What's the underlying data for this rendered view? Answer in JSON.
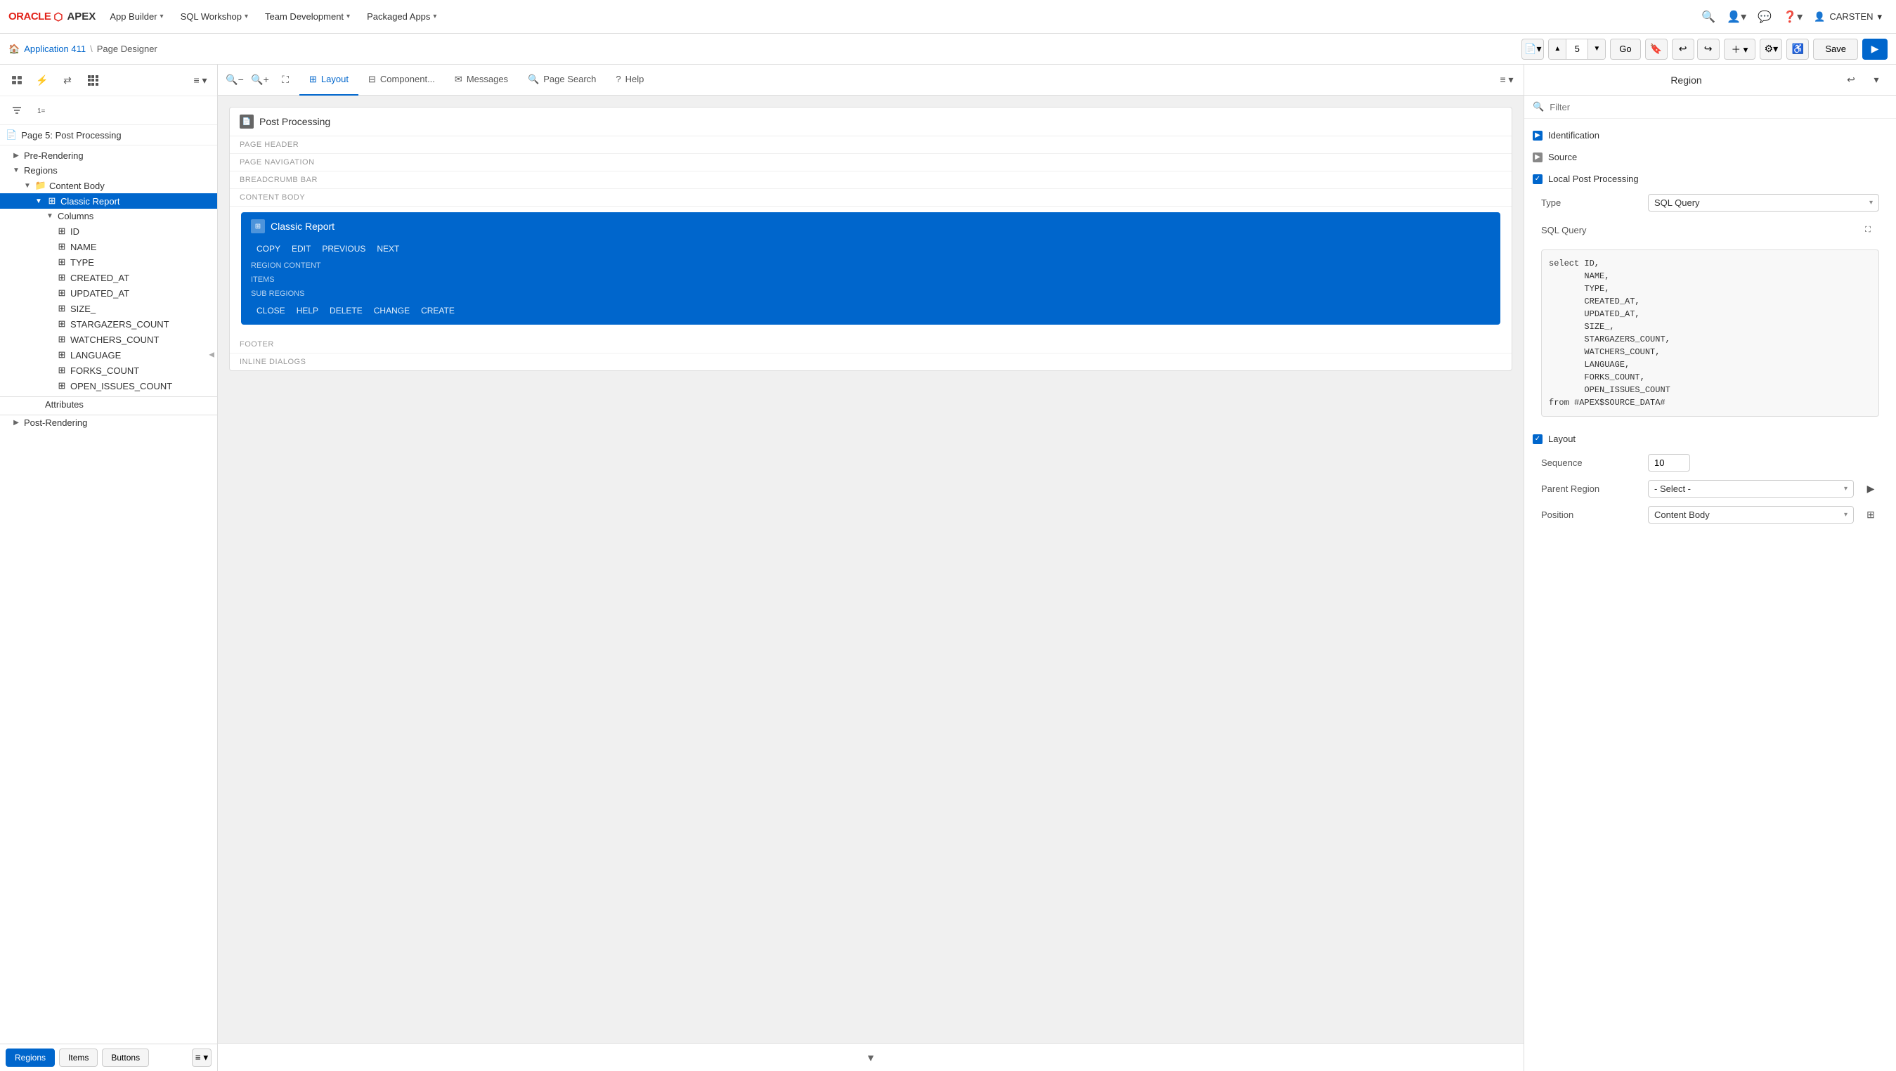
{
  "app": {
    "oracle_text": "ORACLE",
    "apex_text": "APEX"
  },
  "top_nav": {
    "app_builder": "App Builder",
    "sql_workshop": "SQL Workshop",
    "team_development": "Team Development",
    "packaged_apps": "Packaged Apps"
  },
  "page_toolbar": {
    "application_link": "Application 411",
    "separator": "\\",
    "page_designer": "Page Designer",
    "page_number": "5",
    "go_label": "Go",
    "save_label": "Save"
  },
  "left_panel": {
    "page_title": "Page 5: Post Processing",
    "items": [
      {
        "label": "Pre-Rendering",
        "level": 1,
        "toggle": "▶"
      },
      {
        "label": "Regions",
        "level": 1,
        "toggle": "▼"
      },
      {
        "label": "Content Body",
        "level": 2,
        "toggle": "▼"
      },
      {
        "label": "Classic Report",
        "level": 3,
        "toggle": "▼",
        "selected": true
      },
      {
        "label": "Columns",
        "level": 4,
        "toggle": "▼"
      },
      {
        "label": "ID",
        "level": 5
      },
      {
        "label": "NAME",
        "level": 5
      },
      {
        "label": "TYPE",
        "level": 5
      },
      {
        "label": "CREATED_AT",
        "level": 5
      },
      {
        "label": "UPDATED_AT",
        "level": 5
      },
      {
        "label": "SIZE_",
        "level": 5
      },
      {
        "label": "STARGAZERS_COUNT",
        "level": 5
      },
      {
        "label": "WATCHERS_COUNT",
        "level": 5
      },
      {
        "label": "LANGUAGE",
        "level": 5
      },
      {
        "label": "FORKS_COUNT",
        "level": 5
      },
      {
        "label": "OPEN_ISSUES_COUNT",
        "level": 5
      },
      {
        "label": "Attributes",
        "level": 4
      },
      {
        "label": "Post-Rendering",
        "level": 1,
        "toggle": "▶"
      }
    ],
    "bottom_tabs": {
      "regions": "Regions",
      "items": "Items",
      "buttons": "Buttons"
    }
  },
  "middle_panel": {
    "tabs": [
      {
        "label": "Layout",
        "icon": "⊞"
      },
      {
        "label": "Component...",
        "icon": "⊟"
      },
      {
        "label": "Messages",
        "icon": "✉"
      },
      {
        "label": "Page Search",
        "icon": "🔍"
      },
      {
        "label": "Help",
        "icon": "?"
      }
    ],
    "canvas": {
      "page_title": "Post Processing",
      "sections": [
        {
          "label": "PAGE HEADER"
        },
        {
          "label": "PAGE NAVIGATION"
        },
        {
          "label": "BREADCRUMB BAR"
        },
        {
          "label": "CONTENT BODY"
        }
      ],
      "report": {
        "title": "Classic Report",
        "top_actions": [
          "COPY",
          "EDIT",
          "PREVIOUS",
          "NEXT"
        ],
        "region_content": "REGION CONTENT",
        "items": "ITEMS",
        "sub_regions": "SUB REGIONS",
        "bottom_actions": [
          "CLOSE",
          "HELP",
          "DELETE",
          "CHANGE",
          "CREATE"
        ]
      },
      "footer_sections": [
        {
          "label": "FOOTER"
        },
        {
          "label": "INLINE DIALOGS"
        }
      ]
    }
  },
  "right_panel": {
    "title": "Region",
    "filter_placeholder": "Filter",
    "sections": {
      "identification": {
        "label": "Identification",
        "expanded": true
      },
      "source": {
        "label": "Source",
        "expanded": false
      },
      "local_post_processing": {
        "label": "Local Post Processing",
        "expanded": true,
        "type_label": "Type",
        "type_value": "SQL Query",
        "sql_query_label": "SQL Query",
        "sql_code": "select ID,\n       NAME,\n       TYPE,\n       CREATED_AT,\n       UPDATED_AT,\n       SIZE_,\n       STARGAZERS_COUNT,\n       WATCHERS_COUNT,\n       LANGUAGE,\n       FORKS_COUNT,\n       OPEN_ISSUES_COUNT\nfrom #APEX$SOURCE_DATA#"
      },
      "layout": {
        "label": "Layout",
        "expanded": true,
        "sequence_label": "Sequence",
        "sequence_value": "10",
        "parent_region_label": "Parent Region",
        "parent_region_value": "- Select -",
        "position_label": "Position",
        "position_value": "Content Body"
      }
    }
  },
  "colors": {
    "accent": "#0066cc",
    "selected_bg": "#0066cc",
    "report_bg": "#0066cc",
    "border": "#dddddd",
    "text_muted": "#888888"
  }
}
